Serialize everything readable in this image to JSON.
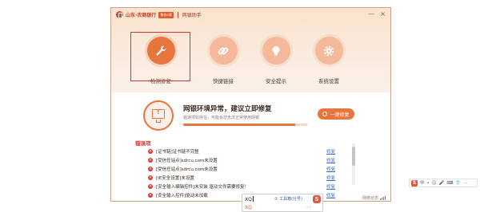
{
  "window": {
    "bank_name": "山东·农商银行",
    "bank_badge": "鲁农e通",
    "app_name": "网银助手",
    "minimize_glyph": "—",
    "close_glyph": "×"
  },
  "nav": {
    "items": [
      {
        "label": "检测修复",
        "icon": "wrench-icon",
        "active": true
      },
      {
        "label": "快捷链接",
        "icon": "link-icon",
        "active": false
      },
      {
        "label": "安全提示",
        "icon": "lightbulb-icon",
        "active": false
      },
      {
        "label": "系统设置",
        "icon": "gear-icon",
        "active": false
      }
    ]
  },
  "alert": {
    "title": "网银环境异常，建议立即修复",
    "subtitle": "错误项如存在，可能会您无法正常使用网银",
    "fix_button": "一键修复",
    "progress_fraction": 0.9
  },
  "errors": {
    "title": "错误项",
    "fix_label": "修复",
    "items": [
      "[证书链]证书链不完整",
      "[受信任站点]sdrcu.com未设置",
      "[受信任站点]sdrcu.com未设置",
      "[IE安全设置]未设置",
      "[安全输入编辑控件]未安装 驱动文件需要修复！",
      "[安全输入控件]驱动未加载"
    ]
  },
  "status": {
    "label": "网络状态"
  },
  "ime": {
    "typed": "XQ",
    "toolbox": "① 工具箱(分号)",
    "candidate": "XQ",
    "logo": "S",
    "bar_items": [
      "中",
      "•",
      "☺",
      "🎤",
      "⌨",
      "👕",
      "⋯"
    ]
  },
  "colors": {
    "accent": "#e8743e",
    "error": "#d8362a",
    "link": "#3a6ec6"
  }
}
